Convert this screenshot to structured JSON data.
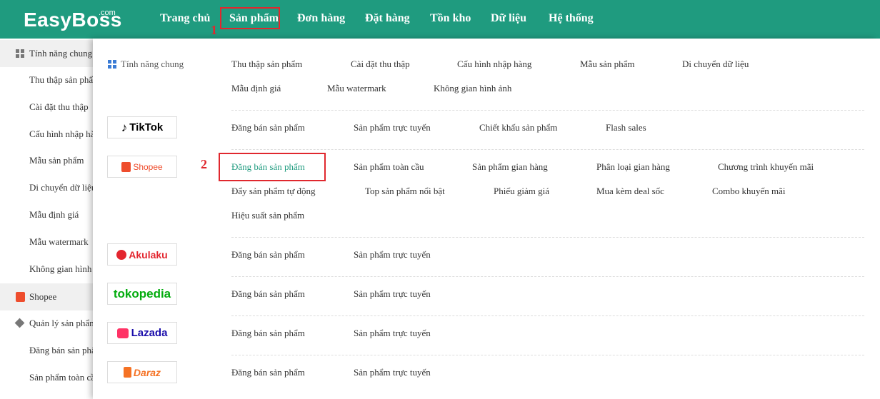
{
  "header": {
    "logo_text": "EasyBoss",
    "logo_suffix": ".com",
    "nav": [
      "Trang chủ",
      "Sản phẩm",
      "Đơn hàng",
      "Đặt hàng",
      "Tồn kho",
      "Dữ liệu",
      "Hệ thống"
    ],
    "active_nav": "Sản phẩm",
    "annotation_1": "1"
  },
  "sidebar": {
    "group_general": "Tính năng chung",
    "items_general": [
      "Thu thập sản phẩm",
      "Cài đặt thu thập",
      "Cấu hình nhập hàng",
      "Mẫu sản phẩm",
      "Di chuyển dữ liệu",
      "Mẫu định giá",
      "Mẫu watermark",
      "Không gian hình ảnh"
    ],
    "group_shopee": "Shopee",
    "subgroup_shopee": "Quản lý sản phẩm",
    "items_shopee": [
      "Đăng bán sản phẩm",
      "Sản phẩm toàn cầu"
    ]
  },
  "menu": {
    "general_label": "Tính năng chung",
    "general_links": [
      "Thu thập sản phẩm",
      "Cài đặt thu thập",
      "Cấu hình nhập hàng",
      "Mẫu sản phẩm",
      "Di chuyển dữ liệu",
      "Mẫu định giá",
      "Mẫu watermark",
      "Không gian hình ảnh"
    ],
    "tiktok": {
      "logo": "TikTok",
      "links": [
        "Đăng bán sản phẩm",
        "Sản phẩm trực tuyến",
        "Chiết khấu sản phẩm",
        "Flash sales"
      ]
    },
    "shopee": {
      "logo": "Shopee",
      "links": [
        "Đăng bán sản phẩm",
        "Sản phẩm toàn cầu",
        "Sản phẩm gian hàng",
        "Phân loại gian hàng",
        "Chương trình khuyến mãi",
        "Đẩy sản phẩm tự động",
        "Top sản phẩm nổi bật",
        "Phiếu giảm giá",
        "Mua kèm deal sốc",
        "Combo khuyến mãi",
        "Hiệu suất sản phẩm"
      ]
    },
    "akulaku": {
      "logo": "Akulaku",
      "links": [
        "Đăng bán sản phẩm",
        "Sản phẩm trực tuyến"
      ]
    },
    "tokopedia": {
      "logo": "tokopedia",
      "links": [
        "Đăng bán sản phẩm",
        "Sản phẩm trực tuyến"
      ]
    },
    "lazada": {
      "logo": "Lazada",
      "links": [
        "Đăng bán sản phẩm",
        "Sản phẩm trực tuyến"
      ]
    },
    "daraz": {
      "logo": "Daraz",
      "links": [
        "Đăng bán sản phẩm",
        "Sản phẩm trực tuyến"
      ]
    },
    "annotation_2": "2"
  },
  "colors": {
    "brand": "#1f9b7f",
    "annotation": "#e0282e",
    "tiktok": "#000000",
    "shopee": "#ee4d2d",
    "akulaku": "#e3262f",
    "tokopedia": "#03ac0e",
    "lazada": "#1a0dab",
    "daraz": "#f57224"
  }
}
